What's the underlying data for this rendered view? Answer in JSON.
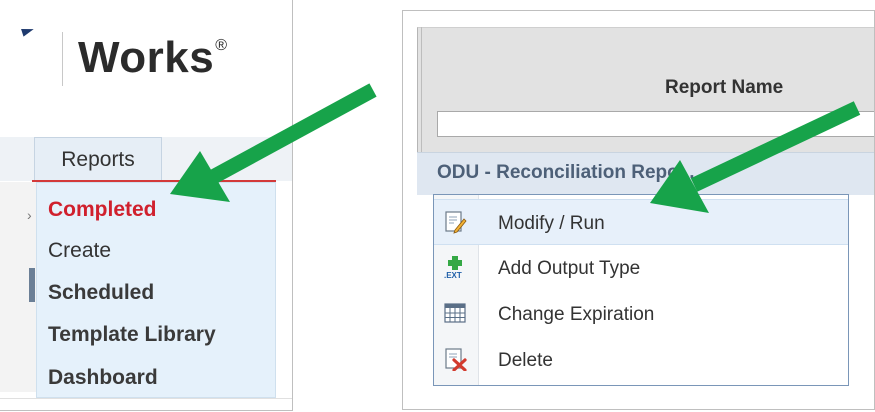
{
  "brand": {
    "name": "Works",
    "mark": "®"
  },
  "left_menu": {
    "tab_label": "Reports",
    "items": [
      {
        "label": "Completed",
        "active": true
      },
      {
        "label": "Create",
        "active": false
      },
      {
        "label": "Scheduled",
        "active": false
      },
      {
        "label": "Template Library",
        "active": false
      },
      {
        "label": "Dashboard",
        "active": false
      }
    ]
  },
  "report_grid": {
    "column_header": "Report Name",
    "filter_value": "",
    "row_name": "ODU - Reconciliation Repo..."
  },
  "context_menu": {
    "items": [
      {
        "label": "Modify / Run",
        "icon": "edit-document-icon"
      },
      {
        "label": "Add Output Type",
        "icon": "add-extension-icon",
        "icon_text": ".EXT"
      },
      {
        "label": "Change Expiration",
        "icon": "calendar-grid-icon"
      },
      {
        "label": "Delete",
        "icon": "delete-document-icon"
      }
    ]
  },
  "colors": {
    "accent_red": "#d0202d",
    "menu_bg": "#e5f1fb",
    "arrow_green": "#17a34a",
    "row_text": "#4d6078"
  },
  "annotations": {
    "arrow_count": 2,
    "arrow_color": "green"
  }
}
